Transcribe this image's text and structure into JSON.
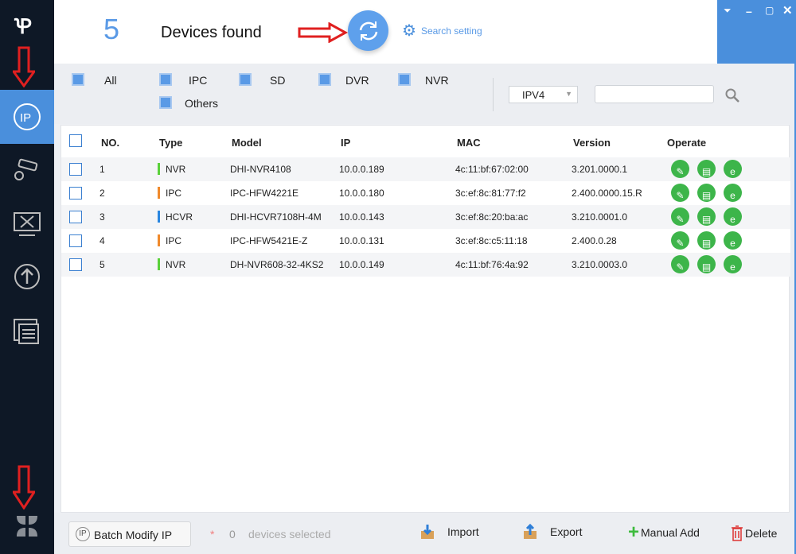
{
  "header": {
    "count": "5",
    "title": "Devices found",
    "search_setting": "Search setting"
  },
  "filters": {
    "items": [
      "All",
      "IPC",
      "SD",
      "DVR",
      "NVR",
      "Others"
    ],
    "protocol": "IPV4",
    "search_value": ""
  },
  "table": {
    "columns": [
      "NO.",
      "Type",
      "Model",
      "IP",
      "MAC",
      "Version",
      "Operate"
    ],
    "rows": [
      {
        "no": "1",
        "type": "NVR",
        "type_color": "#5ad13a",
        "model": "DHI-NVR4108",
        "ip": "10.0.0.189",
        "mac": "4c:11:bf:67:02:00",
        "version": "3.201.0000.1"
      },
      {
        "no": "2",
        "type": "IPC",
        "type_color": "#f08a2c",
        "model": "IPC-HFW4221E",
        "ip": "10.0.0.180",
        "mac": "3c:ef:8c:81:77:f2",
        "version": "2.400.0000.15.R"
      },
      {
        "no": "3",
        "type": "HCVR",
        "type_color": "#2a86e0",
        "model": "DHI-HCVR7108H-4M",
        "ip": "10.0.0.143",
        "mac": "3c:ef:8c:20:ba:ac",
        "version": "3.210.0001.0"
      },
      {
        "no": "4",
        "type": "IPC",
        "type_color": "#f08a2c",
        "model": "IPC-HFW5421E-Z",
        "ip": "10.0.0.131",
        "mac": "3c:ef:8c:c5:11:18",
        "version": "2.400.0.28"
      },
      {
        "no": "5",
        "type": "NVR",
        "type_color": "#5ad13a",
        "model": "DH-NVR608-32-4KS2",
        "ip": "10.0.0.149",
        "mac": "4c:11:bf:76:4a:92",
        "version": "3.210.0003.0"
      }
    ]
  },
  "bottom": {
    "batch": "Batch Modify IP",
    "star": "*",
    "selected_count": "0",
    "selected_text": "devices selected",
    "import": "Import",
    "export": "Export",
    "manual_add": "Manual Add",
    "delete": "Delete"
  },
  "colors": {
    "accent": "#4a8fdc",
    "sidebar": "#0e1826",
    "operate": "#3db54a"
  }
}
